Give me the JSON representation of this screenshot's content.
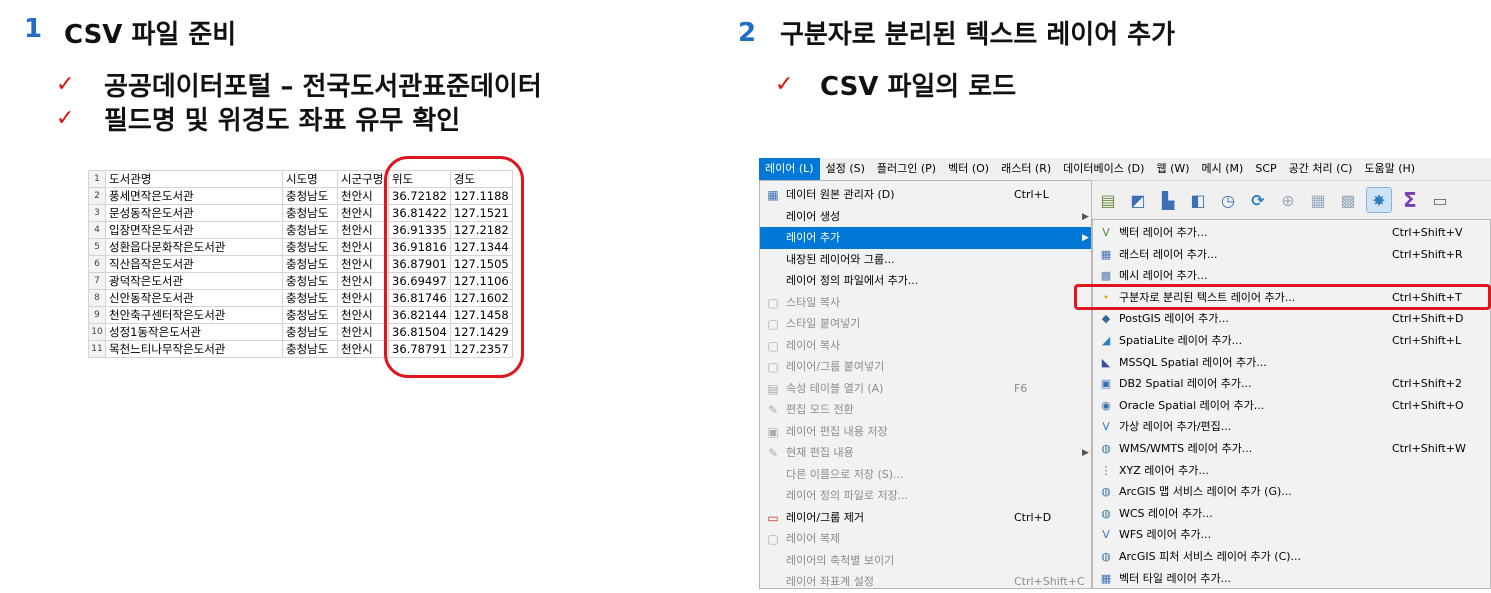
{
  "left_section": {
    "number": "1",
    "title": "CSV 파일 준비",
    "checks": [
      "공공데이터포털 – 전국도서관표준데이터",
      "필드명 및 위경도 좌표 유무 확인"
    ]
  },
  "right_section": {
    "number": "2",
    "title": "구분자로 분리된 텍스트 레이어 추가",
    "checks": [
      "CSV 파일의 로드"
    ]
  },
  "spreadsheet": {
    "check_mark": "✓",
    "headers": [
      "1",
      "도서관명",
      "시도명",
      "시군구명",
      "위도",
      "경도"
    ],
    "rows": [
      [
        "2",
        "풍세면작은도서관",
        "충청남도",
        "천안시",
        "36.72182",
        "127.1188"
      ],
      [
        "3",
        "문성동작은도서관",
        "충청남도",
        "천안시",
        "36.81422",
        "127.1521"
      ],
      [
        "4",
        "입장면작은도서관",
        "충청남도",
        "천안시",
        "36.91335",
        "127.2182"
      ],
      [
        "5",
        "성환읍다문화작은도서관",
        "충청남도",
        "천안시",
        "36.91816",
        "127.1344"
      ],
      [
        "6",
        "직산읍작은도서관",
        "충청남도",
        "천안시",
        "36.87901",
        "127.1505"
      ],
      [
        "7",
        "광덕작은도서관",
        "충청남도",
        "천안시",
        "36.69497",
        "127.1106"
      ],
      [
        "8",
        "신안동작은도서관",
        "충청남도",
        "천안시",
        "36.81746",
        "127.1602"
      ],
      [
        "9",
        "천안축구센터작은도서관",
        "충청남도",
        "천안시",
        "36.82144",
        "127.1458"
      ],
      [
        "10",
        "성정1동작은도서관",
        "충청남도",
        "천안시",
        "36.81504",
        "127.1429"
      ],
      [
        "11",
        "목천느티나무작은도서관",
        "충청남도",
        "천안시",
        "36.78791",
        "127.2357"
      ]
    ]
  },
  "qgis": {
    "menubar": [
      "레이어 (L)",
      "설정 (S)",
      "플러그인 (P)",
      "벡터 (O)",
      "래스터 (R)",
      "데이터베이스 (D)",
      "웹 (W)",
      "메시 (M)",
      "SCP",
      "공간 처리 (C)",
      "도움말 (H)"
    ],
    "layer_menu": [
      {
        "label": "데이터 원본 관리자 (D)",
        "shortcut": "Ctrl+L",
        "icon": "data-source-icon",
        "state": "normal",
        "submenu": false
      },
      {
        "label": "레이어 생성",
        "shortcut": "",
        "icon": "",
        "state": "normal",
        "submenu": true
      },
      {
        "label": "레이어 추가",
        "shortcut": "",
        "icon": "",
        "state": "selected",
        "submenu": true
      },
      {
        "label": "내장된 레이어와 그룹...",
        "shortcut": "",
        "icon": "",
        "state": "normal",
        "submenu": false
      },
      {
        "label": "레이어 정의 파일에서 추가...",
        "shortcut": "",
        "icon": "",
        "state": "normal",
        "submenu": false
      },
      {
        "label": "스타일 복사",
        "shortcut": "",
        "icon": "copy-style-icon",
        "state": "disabled",
        "submenu": false
      },
      {
        "label": "스타일 붙여넣기",
        "shortcut": "",
        "icon": "paste-style-icon",
        "state": "disabled",
        "submenu": false
      },
      {
        "label": "레이어 복사",
        "shortcut": "",
        "icon": "copy-layer-icon",
        "state": "disabled",
        "submenu": false
      },
      {
        "label": "레이어/그룹 붙여넣기",
        "shortcut": "",
        "icon": "paste-layer-icon",
        "state": "disabled",
        "submenu": false
      },
      {
        "label": "속성 테이블 열기 (A)",
        "shortcut": "F6",
        "icon": "table-icon",
        "state": "disabled",
        "submenu": false
      },
      {
        "label": "편집 모드 전환",
        "shortcut": "",
        "icon": "pencil-icon",
        "state": "disabled",
        "submenu": false
      },
      {
        "label": "레이어 편집 내용 저장",
        "shortcut": "",
        "icon": "save-edits-icon",
        "state": "disabled",
        "submenu": false
      },
      {
        "label": "현재 편집 내용",
        "shortcut": "",
        "icon": "edit-icon",
        "state": "disabled",
        "submenu": true
      },
      {
        "label": "다른 이름으로 저장 (S)...",
        "shortcut": "",
        "icon": "",
        "state": "disabled",
        "submenu": false
      },
      {
        "label": "레이어 정의 파일로 저장...",
        "shortcut": "",
        "icon": "",
        "state": "disabled",
        "submenu": false
      },
      {
        "label": "레이어/그룹 제거",
        "shortcut": "Ctrl+D",
        "icon": "remove-layer-icon",
        "state": "normal",
        "submenu": false
      },
      {
        "label": "레이어 복제",
        "shortcut": "",
        "icon": "duplicate-layer-icon",
        "state": "disabled",
        "submenu": false
      },
      {
        "label": "레이어의 축척별 보이기",
        "shortcut": "",
        "icon": "",
        "state": "disabled",
        "submenu": false
      },
      {
        "label": "레이어 좌표계 설정",
        "shortcut": "Ctrl+Shift+C",
        "icon": "",
        "state": "disabled",
        "submenu": false
      }
    ],
    "add_layer_menu": [
      {
        "label": "벡터 레이어 추가...",
        "shortcut": "Ctrl+Shift+V",
        "icon": "vector-layer-icon",
        "color": "#4a8a3c"
      },
      {
        "label": "래스터 레이어 추가...",
        "shortcut": "Ctrl+Shift+R",
        "icon": "raster-layer-icon",
        "color": "#3b6fb6"
      },
      {
        "label": "메시 레이어 추가...",
        "shortcut": "",
        "icon": "mesh-layer-icon",
        "color": "#5a7fb0"
      },
      {
        "label": "구분자로 분리된 텍스트 레이어 추가...",
        "shortcut": "Ctrl+Shift+T",
        "icon": "delimited-text-icon",
        "color": "#e0b020"
      },
      {
        "label": "PostGIS 레이어 추가...",
        "shortcut": "Ctrl+Shift+D",
        "icon": "postgis-icon",
        "color": "#336699"
      },
      {
        "label": "SpatiaLite 레이어 추가...",
        "shortcut": "Ctrl+Shift+L",
        "icon": "spatialite-icon",
        "color": "#2f7fc0"
      },
      {
        "label": "MSSQL Spatial 레이어 추가...",
        "shortcut": "",
        "icon": "mssql-icon",
        "color": "#3a4a9a"
      },
      {
        "label": "DB2 Spatial 레이어 추가...",
        "shortcut": "Ctrl+Shift+2",
        "icon": "db2-icon",
        "color": "#3a6fb0"
      },
      {
        "label": "Oracle Spatial 레이어 추가...",
        "shortcut": "Ctrl+Shift+O",
        "icon": "oracle-icon",
        "color": "#3a6fb0"
      },
      {
        "label": "가상 레이어 추가/편집...",
        "shortcut": "",
        "icon": "virtual-layer-icon",
        "color": "#3b7fc0"
      },
      {
        "label": "WMS/WMTS 레이어 추가...",
        "shortcut": "Ctrl+Shift+W",
        "icon": "wms-icon",
        "color": "#3f7aa0"
      },
      {
        "label": "XYZ 레이어 추가...",
        "shortcut": "",
        "icon": "xyz-icon",
        "color": "#3b6fb6"
      },
      {
        "label": "ArcGIS 맵 서비스 레이어 추가 (G)...",
        "shortcut": "",
        "icon": "arcgis-map-icon",
        "color": "#3f7aa0"
      },
      {
        "label": "WCS 레이어 추가...",
        "shortcut": "",
        "icon": "wcs-icon",
        "color": "#3f7aa0"
      },
      {
        "label": "WFS 레이어 추가...",
        "shortcut": "",
        "icon": "wfs-icon",
        "color": "#3b7fc0"
      },
      {
        "label": "ArcGIS 피처 서비스 레이어 추가 (C)...",
        "shortcut": "",
        "icon": "arcgis-feature-icon",
        "color": "#3f7aa0"
      },
      {
        "label": "벡터 타일 레이어 추가...",
        "shortcut": "",
        "icon": "vector-tile-icon",
        "color": "#3b6fb6"
      }
    ],
    "toolbar_icons": [
      "add-delimited-icon",
      "add-layer-icon",
      "add-wfs-icon",
      "bookmark-icon",
      "clock-icon",
      "refresh-icon",
      "identify-icon",
      "table-icon",
      "grid-icon",
      "settings-star-icon",
      "sigma-icon",
      "ruler-icon"
    ],
    "colors": {
      "highlight": "#0078d7",
      "annotation": "#e0161e"
    }
  }
}
